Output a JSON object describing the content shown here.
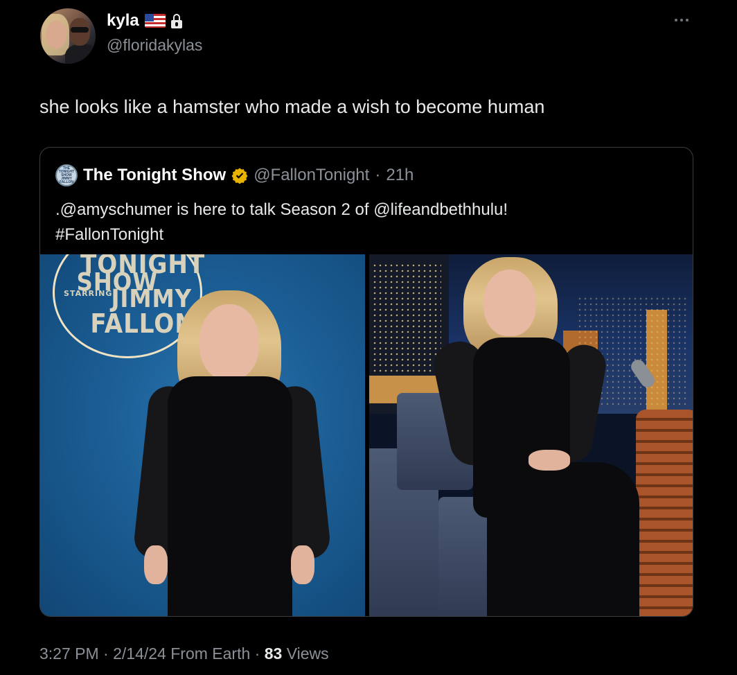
{
  "author": {
    "display_name": "kyla",
    "handle": "@floridakylas",
    "badges": [
      "us-flag-icon",
      "lock-icon"
    ]
  },
  "tweet": {
    "text": "she looks like a hamster who made a wish to become human"
  },
  "quoted": {
    "avatar_text": "THE TONIGHT SHOW JIMMY FALLON",
    "name": "The Tonight Show",
    "handle": "@FallonTonight",
    "separator": "·",
    "time": "21h",
    "text_line1": ".@amyschumer is here to talk Season 2 of @lifeandbethhulu!",
    "text_line2": "#FallonTonight",
    "verified_color": "#e8b400"
  },
  "photo_logo": {
    "line1": "TONIGHT",
    "line2": "SHOW",
    "starring": "STARRING",
    "line3": "JIMMY",
    "line4": "FALLON"
  },
  "meta": {
    "time": "3:27 PM",
    "sep1": "·",
    "date": "2/14/24",
    "from": "From Earth",
    "sep2": "·",
    "views_count": "83",
    "views_label": "Views"
  }
}
